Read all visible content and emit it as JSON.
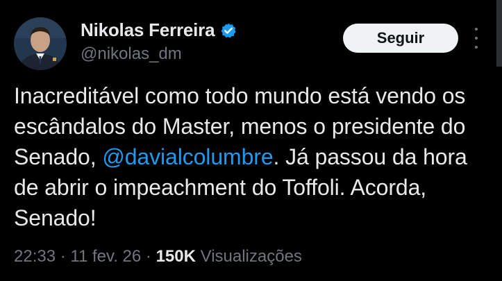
{
  "author": {
    "display_name": "Nikolas Ferreira",
    "handle": "@nikolas_dm",
    "verified_icon": "verified-badge-icon",
    "verified_color": "#1d9bf0"
  },
  "actions": {
    "follow_label": "Seguir",
    "more_icon": "more-options-icon"
  },
  "tweet": {
    "text_before_mention": "Inacreditável como todo mundo está vendo os escândalos do Master, menos o presidente do Senado, ",
    "mention": "@davialcolumbre",
    "text_after_mention": ". Já passou da hora de abrir o impeachment do Toffoli. Acorda, Senado!"
  },
  "meta": {
    "time": "22:33",
    "separator1": " · ",
    "date": "11 fev. 26",
    "separator2": " · ",
    "views_count": "150K",
    "views_label": " Visualizações"
  },
  "colors": {
    "background": "#000000",
    "text": "#e7e9ea",
    "secondary": "#71767b",
    "link": "#1d9bf0",
    "button_bg": "#eff3f4"
  }
}
